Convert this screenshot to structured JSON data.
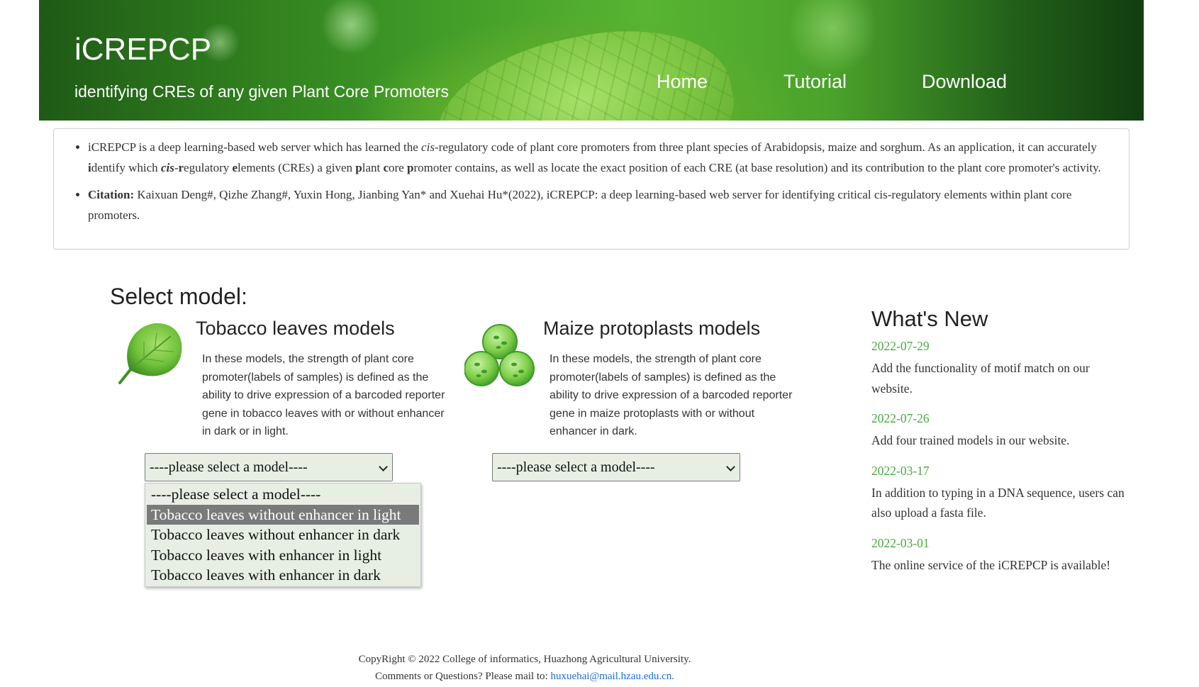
{
  "header": {
    "title": "iCREPCP",
    "subtitle": "identifying CREs of any given Plant Core Promoters",
    "nav": [
      {
        "label": "Home"
      },
      {
        "label": "Tutorial"
      },
      {
        "label": "Download"
      }
    ]
  },
  "intro": {
    "summary_p1": "iCREPCP is a deep learning-based web server which has learned the ",
    "summary_cis": "cis",
    "summary_p2": "-regulatory code of plant core promoters from three plant species of Arabidopsis, maize and sorghum. As an application, it can accurately ",
    "summary_i": "i",
    "summary_p3": "dentify which ",
    "summary_cis_bold": "cis",
    "summary_dash": "-",
    "summary_r": "r",
    "summary_p4": "egulatory ",
    "summary_e": "e",
    "summary_p5": "lements (CREs) a given ",
    "summary_p": "p",
    "summary_p6": "lant ",
    "summary_c": "c",
    "summary_p7": "ore ",
    "summary_p_bold2": "p",
    "summary_p8": "romoter contains, as well as locate the exact position of each CRE (at base resolution) and its contribution to the plant core promoter's activity.",
    "citation_label": "Citation:",
    "citation_text": " Kaixuan Deng#, Qizhe Zhang#, Yuxin Hong, Jianbing Yan* and Xuehai Hu*(2022), iCREPCP: a deep learning-based web server for identifying critical cis-regulatory elements within plant core promoters."
  },
  "select_model": {
    "heading": "Select model:",
    "tobacco": {
      "title": "Tobacco leaves models",
      "description": "In these models, the strength of plant core promoter(labels of samples) is defined as the ability to drive expression of a barcoded reporter gene in tobacco leaves with or without enhancer in dark or in light.",
      "select_value": "----please select a model----",
      "options": [
        "----please select a model----",
        "Tobacco leaves without enhancer in light",
        "Tobacco leaves without enhancer in dark",
        "Tobacco leaves with enhancer in light",
        "Tobacco leaves with enhancer in dark"
      ],
      "highlighted_option": "Tobacco leaves without enhancer in light"
    },
    "maize": {
      "title": "Maize protoplasts models",
      "description": "In these models, the strength of plant core promoter(labels of samples) is defined as the ability to drive expression of a barcoded reporter gene in maize protoplasts with or without enhancer in dark.",
      "select_value": "----please select a model----"
    }
  },
  "news": {
    "title": "What's New",
    "items": [
      {
        "date": "2022-07-29",
        "text": "Add the functionality of motif match on our website."
      },
      {
        "date": "2022-07-26",
        "text": "Add four trained models in our website."
      },
      {
        "date": "2022-03-17",
        "text": "In addition to typing in a DNA sequence, users can also upload a fasta file."
      },
      {
        "date": "2022-03-01",
        "text": "The online service of the iCREPCP is available!"
      }
    ]
  },
  "footer": {
    "copyright": "CopyRight © 2022 College of informatics, Huazhong Agricultural University.",
    "contact_prefix": "Comments or Questions? Please mail to: ",
    "email": "huxuehai@mail.hzau.edu.cn."
  },
  "colors": {
    "accent_green": "#4aa843",
    "select_bg": "#e7efe4",
    "link": "#1a6fd1"
  }
}
